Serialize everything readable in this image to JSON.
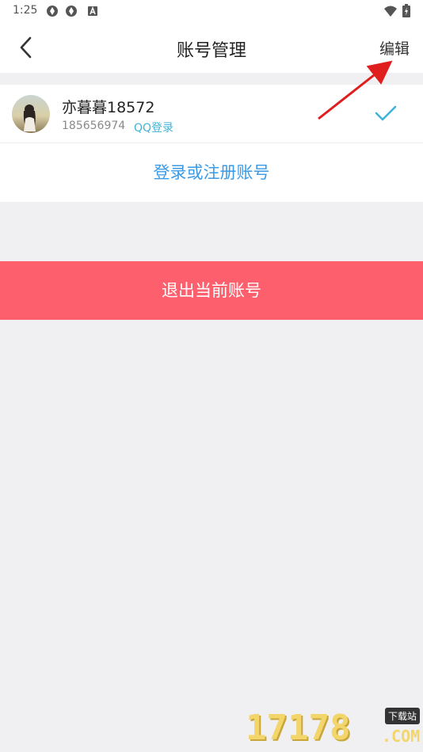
{
  "status_bar": {
    "time": "1:25",
    "icons": [
      "aperture-icon",
      "aperture-icon",
      "notification-a-icon",
      "wifi-icon",
      "battery-charging-icon"
    ]
  },
  "header": {
    "title": "账号管理",
    "edit_label": "编辑",
    "back_icon": "chevron-left-icon"
  },
  "account": {
    "name": "亦暮暮18572",
    "uid": "185656974",
    "login_type": "QQ登录",
    "selected_icon": "checkmark-icon",
    "accent_color": "#3fb3d8"
  },
  "register_label": "登录或注册账号",
  "logout": {
    "label": "退出当前账号",
    "color": "#fe5f6c"
  },
  "annotation": {
    "arrow_color": "#e01e1e"
  },
  "watermark": {
    "digits": "17178",
    "badge": "下载站",
    "suffix": ".COM"
  }
}
